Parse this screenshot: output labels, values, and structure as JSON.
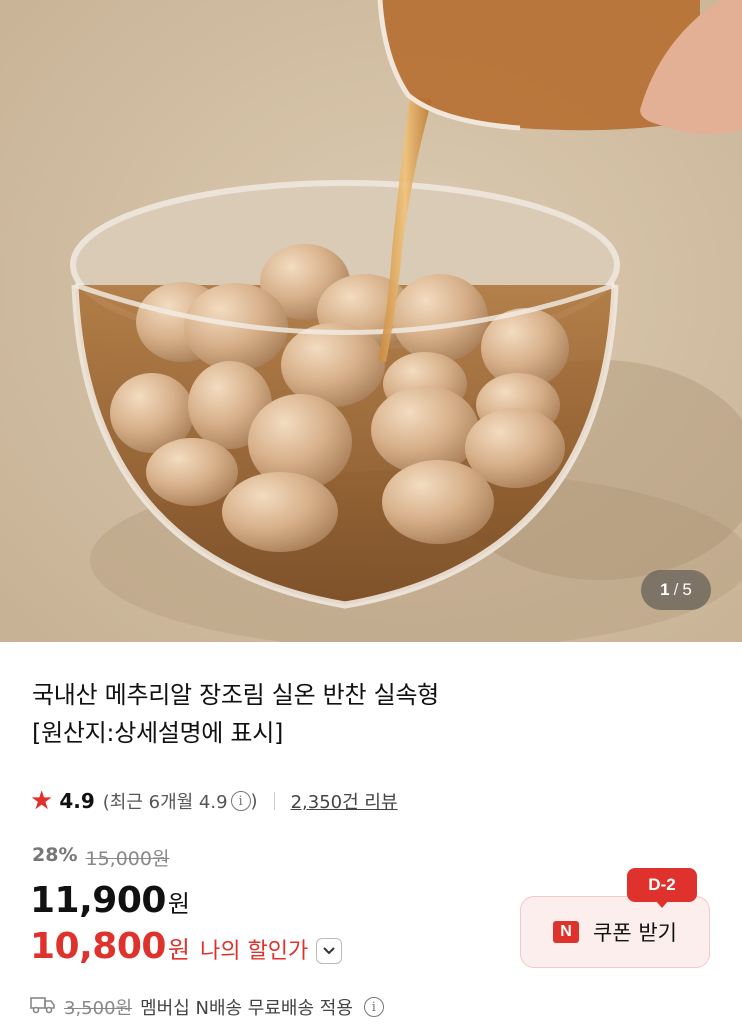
{
  "gallery": {
    "current": "1",
    "separator": "/",
    "total": "5"
  },
  "product": {
    "title_line1": "국내산 메추리알 장조림 실온 반찬 실속형",
    "title_line2": "[원산지:상세설명에 표시]"
  },
  "rating": {
    "score": "4.9",
    "recent_label": "(최근 6개월 4.9",
    "recent_close": ")",
    "reviews": "2,350건 리뷰"
  },
  "pricing": {
    "discount_rate": "28%",
    "original_price": "15,000원",
    "sale_price": "11,900",
    "currency": "원",
    "my_price": "10,800",
    "my_currency": "원",
    "my_price_label": "나의 할인가"
  },
  "coupon": {
    "dday": "D-2",
    "label": "쿠폰 받기",
    "badge": "N"
  },
  "delivery": {
    "fee": "3,500원",
    "text": "멤버십 N배송 무료배송 적용"
  },
  "colors": {
    "accent": "#e0322c",
    "coupon_bg": "#fdeeee"
  },
  "icons": [
    "star-icon",
    "info-icon",
    "chevron-down-icon",
    "truck-icon",
    "n-badge-icon"
  ]
}
